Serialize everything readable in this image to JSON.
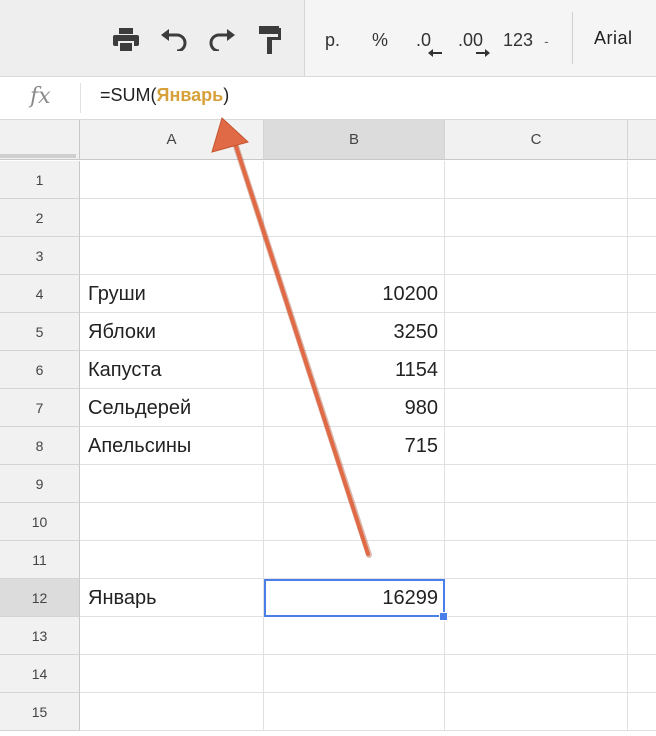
{
  "toolbar": {
    "icons": [
      "print-icon",
      "undo-icon",
      "redo-icon",
      "paint-format-icon"
    ],
    "currency_label": "р.",
    "percent_label": "%",
    "decrease_decimal_label": ".0",
    "increase_decimal_label": ".00",
    "more_formats_label": "123",
    "more_formats_caret": "-",
    "font_name": "Arial"
  },
  "formula_bar": {
    "fx_label": "fx",
    "prefix": "=SUM(",
    "range": "Январь",
    "suffix": ")"
  },
  "columns": [
    "A",
    "B",
    "C"
  ],
  "selected_column": "B",
  "rows": [
    {
      "num": "1",
      "a": "",
      "b": ""
    },
    {
      "num": "2",
      "a": "",
      "b": ""
    },
    {
      "num": "3",
      "a": "",
      "b": ""
    },
    {
      "num": "4",
      "a": "Груши",
      "b": "10200"
    },
    {
      "num": "5",
      "a": "Яблоки",
      "b": "3250"
    },
    {
      "num": "6",
      "a": "Капуста",
      "b": "1154"
    },
    {
      "num": "7",
      "a": "Сельдерей",
      "b": "980"
    },
    {
      "num": "8",
      "a": "Апельсины",
      "b": "715"
    },
    {
      "num": "9",
      "a": "",
      "b": ""
    },
    {
      "num": "10",
      "a": "",
      "b": ""
    },
    {
      "num": "11",
      "a": "",
      "b": ""
    },
    {
      "num": "12",
      "a": "Январь",
      "b": "16299"
    },
    {
      "num": "13",
      "a": "",
      "b": ""
    },
    {
      "num": "14",
      "a": "",
      "b": ""
    },
    {
      "num": "15",
      "a": "",
      "b": ""
    }
  ],
  "selected_row": "12",
  "selected_cell": "B12",
  "colors": {
    "selection": "#4a7ee8",
    "range_highlight": "#d7a13a",
    "annotation_arrow": "#e06a45",
    "brand_strip": "#1aa260"
  }
}
